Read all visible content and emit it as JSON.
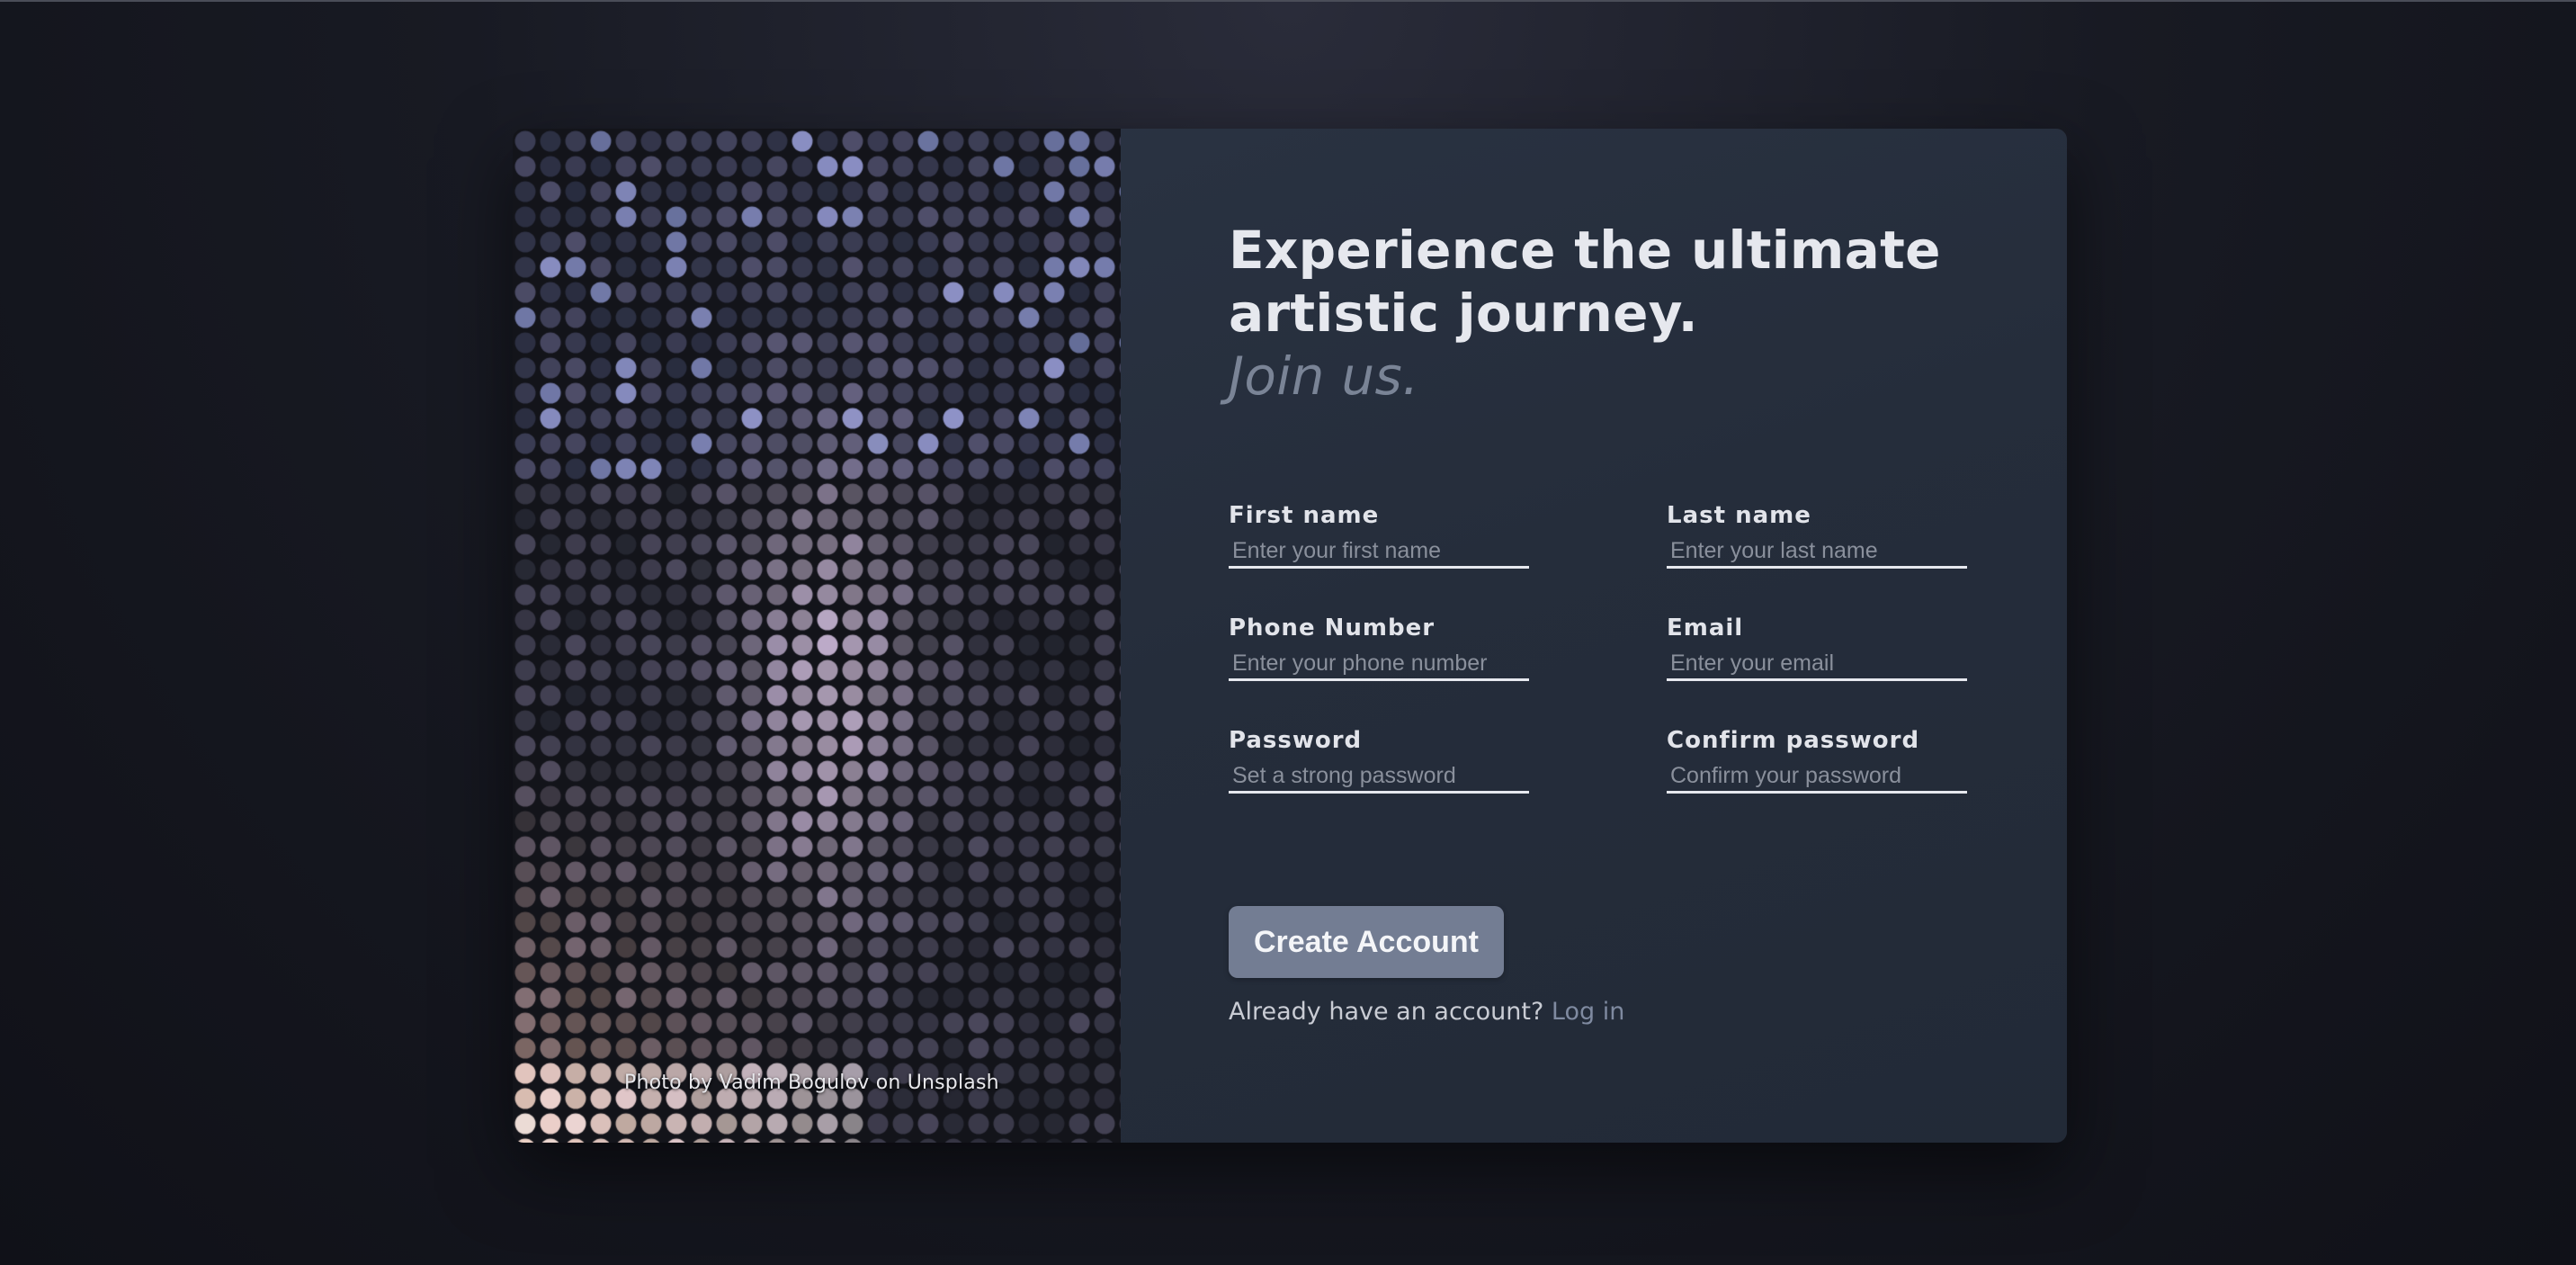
{
  "hero": {
    "photo_credit": "Photo by Vadim Bogulov on Unsplash",
    "photo_alt": "pixelated mosaic photo"
  },
  "headline": {
    "line1": "Experience the ultimate",
    "line2": "artistic journey.",
    "tagline": "Join us."
  },
  "form": {
    "fields": [
      {
        "label": "First name",
        "placeholder": "Enter your first name",
        "value": ""
      },
      {
        "label": "Last name",
        "placeholder": "Enter your last name",
        "value": ""
      },
      {
        "label": "Phone Number",
        "placeholder": "Enter your phone number",
        "value": ""
      },
      {
        "label": "Email",
        "placeholder": "Enter your email",
        "value": ""
      },
      {
        "label": "Password",
        "placeholder": "Set a strong password",
        "value": ""
      },
      {
        "label": "Confirm password",
        "placeholder": "Confirm your password",
        "value": ""
      }
    ],
    "submit_label": "Create Account",
    "login_prompt": "Already have an account?",
    "login_link": "Log in"
  },
  "colors": {
    "card_bg": "#252d3b",
    "page_bg": "#14151d",
    "button_bg": "#737d93",
    "tagline": "#7a8496",
    "link": "#7f8aa0",
    "text": "#e6e8ee"
  }
}
